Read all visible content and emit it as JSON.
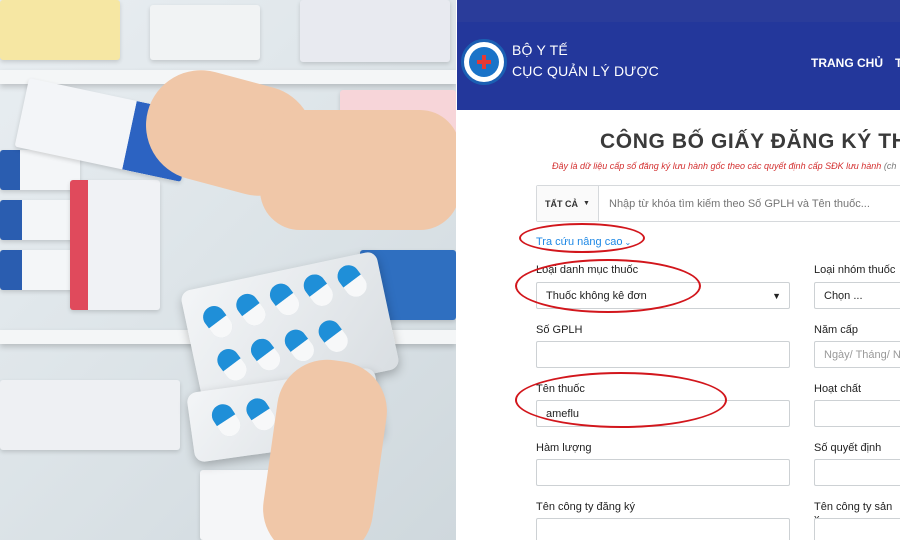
{
  "website": {
    "org_line1": "BỘ Y TẾ",
    "org_line2": "CỤC QUẢN LÝ DƯỢC",
    "nav": [
      "TRANG CHỦ",
      "T"
    ],
    "page_title": "CÔNG BỐ GIẤY ĐĂNG KÝ THUỐC,",
    "subnote": "Đây là dữ liệu cấp số đăng ký lưu hành gốc theo các quyết định cấp SĐK lưu hành",
    "subnote_extra": " (ch",
    "search": {
      "scope_label": "TẤT CẢ",
      "placeholder": "Nhập từ khóa tìm kiếm theo Số GPLH và Tên thuốc..."
    },
    "advanced_search_label": "Tra cứu nâng cao",
    "form": {
      "loai_danh_muc_label": "Loại danh mục thuốc",
      "loai_danh_muc_value": "Thuốc không kê đơn",
      "loai_nhom_label": "Loại nhóm thuốc",
      "loai_nhom_value": "Chọn ...",
      "so_gplh_label": "Số GPLH",
      "so_gplh_value": "",
      "nam_cap_label": "Năm cấp",
      "nam_cap_placeholder": "Ngày/ Tháng/ N",
      "ten_thuoc_label": "Tên thuốc",
      "ten_thuoc_value": "ameflu",
      "hoat_chat_label": "Hoạt chất",
      "hoat_chat_value": "",
      "ham_luong_label": "Hàm lượng",
      "ham_luong_value": "",
      "so_quyet_dinh_label": "Số quyết định",
      "so_quyet_dinh_value": "",
      "ten_cong_ty_dk_label": "Tên công ty đăng ký",
      "ten_cong_ty_dk_value": "",
      "ten_cong_ty_sx_label": "Tên công ty sản x",
      "ten_cong_ty_sx_value": ""
    }
  },
  "colors": {
    "header_bg": "#23379b",
    "annotation": "#d2161c",
    "link": "#1e88e5",
    "note_red": "#d32f2f"
  }
}
